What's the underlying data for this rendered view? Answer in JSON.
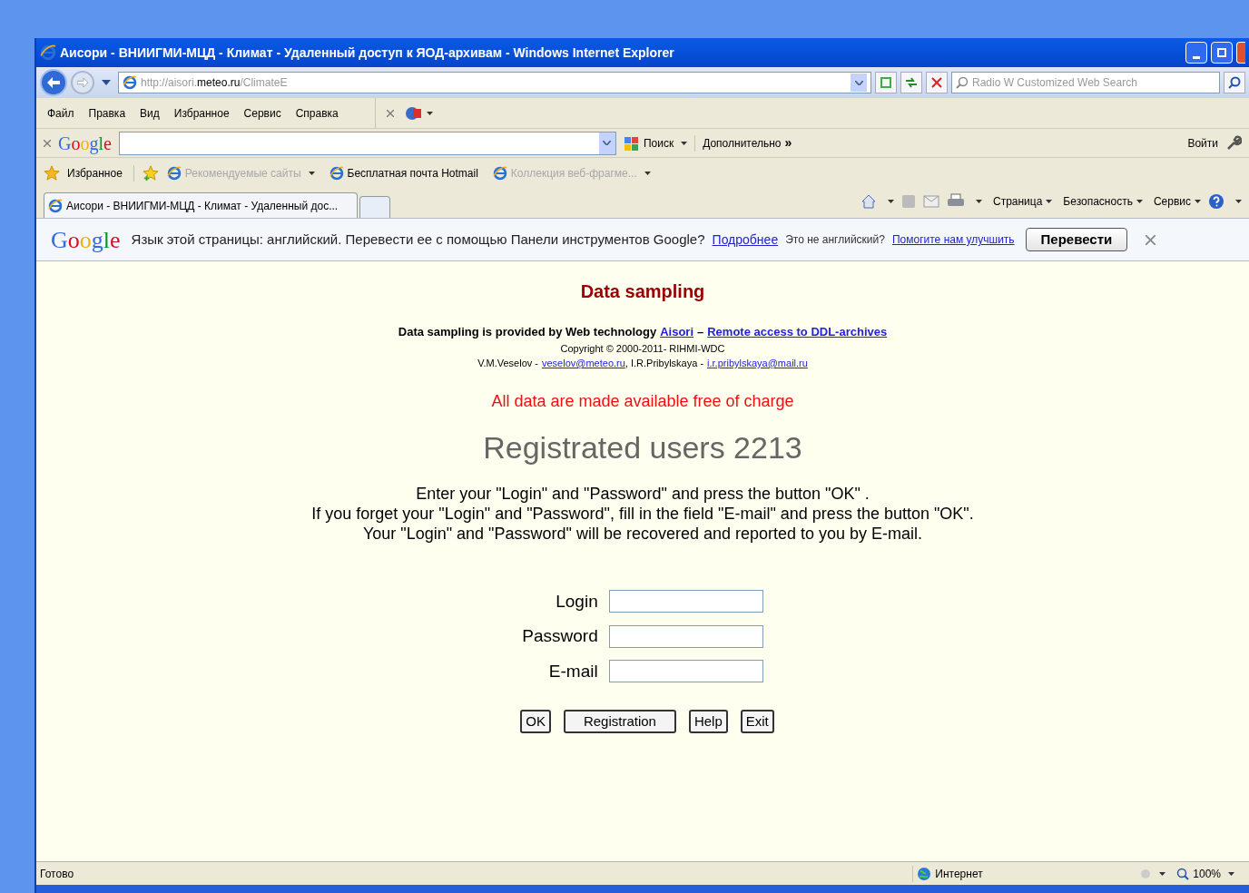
{
  "window": {
    "title": "Аисори - ВНИИГМИ-МЦД - Климат - Удаленный доступ к ЯОД-архивам - Windows Internet Explorer"
  },
  "address_bar": {
    "url_prefix": "http://aisori.",
    "url_domain": "meteo.ru",
    "url_path": "/ClimateE",
    "search_placeholder": "Radio W Customized Web Search"
  },
  "menu": [
    "Файл",
    "Правка",
    "Вид",
    "Избранное",
    "Сервис",
    "Справка"
  ],
  "google_toolbar": {
    "logo": "Google",
    "search_label": "Поиск",
    "more_label": "Дополнительно",
    "more_glyph": "»",
    "signin": "Войти"
  },
  "favorites_bar": {
    "favorites": "Избранное",
    "links": [
      {
        "label": "Рекомендуемые сайты",
        "disabled": true,
        "dropdown": true
      },
      {
        "label": "Бесплатная почта Hotmail",
        "disabled": false,
        "dropdown": false
      },
      {
        "label": "Коллекция веб-фрагме...",
        "disabled": true,
        "dropdown": true
      }
    ]
  },
  "tabs": [
    {
      "label": "Аисори - ВНИИГМИ-МЦД - Климат - Удаленный дос...",
      "selected": true
    }
  ],
  "command_bar": [
    "Страница",
    "Безопасность",
    "Сервис"
  ],
  "translate_bar": {
    "logo": "Google",
    "message": "Язык этой страницы: английский. Перевести ее с помощью Панели инструментов Google?",
    "more_link": "Подробнее",
    "question": "Это не английский?",
    "help_link": "Помогите нам улучшить",
    "button": "Перевести"
  },
  "page": {
    "heading": "Data sampling",
    "provided_text": "Data sampling is provided by Web technology",
    "provided_link": "Aisori",
    "provided_dash": "–",
    "archive_link": "Remote access to DDL-archives",
    "copyright": "Copyright © 2000-2011- RIHMI-WDC",
    "author1": "V.M.Veselov -",
    "email1": "veselov@meteo.ru",
    "author2": ", I.R.Pribylskaya -",
    "email2": "i.r.pribylskaya@mail.ru",
    "free_notice": "All data are made available free of charge",
    "users_count": "Registrated users 2213",
    "instructions": [
      "Enter your \"Login\" and \"Password\" and press the button \"OK\" .",
      "If you forget your \"Login\" and \"Password\", fill in the field \"E-mail\" and press the button \"OK\".",
      "Your \"Login\" and \"Password\" will be recovered and reported to you by E-mail."
    ],
    "fields": [
      {
        "label": "Login"
      },
      {
        "label": "Password"
      },
      {
        "label": "E-mail"
      }
    ],
    "buttons": [
      "OK",
      "Registration",
      "Help",
      "Exit"
    ]
  },
  "status_bar": {
    "status": "Готово",
    "zone": "Интернет",
    "zoom": "100%"
  }
}
